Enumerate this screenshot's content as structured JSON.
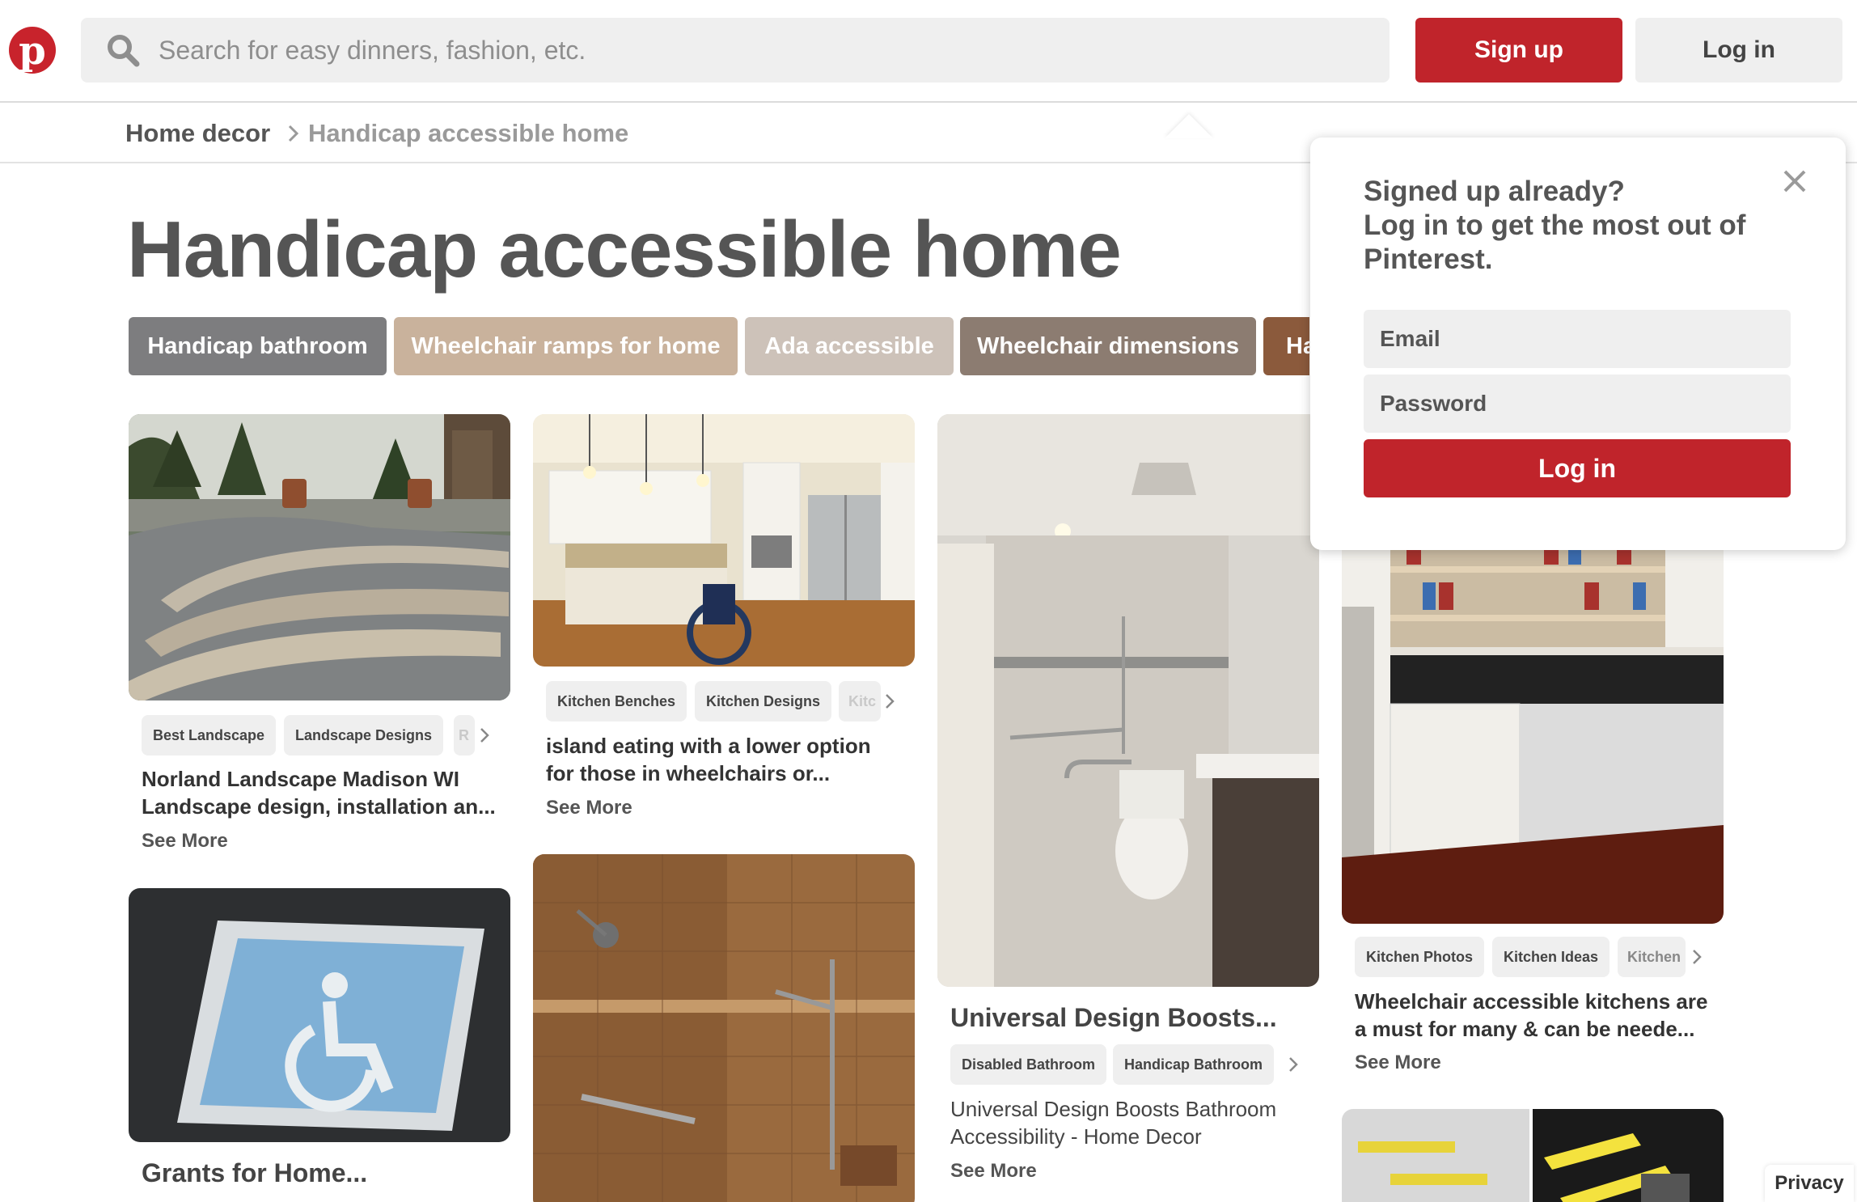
{
  "header": {
    "logo_letter": "p",
    "search_placeholder": "Search for easy dinners, fashion, etc.",
    "signup_label": "Sign up",
    "login_label": "Log in"
  },
  "breadcrumb": {
    "parent": "Home decor",
    "current": "Handicap accessible home"
  },
  "page": {
    "title": "Handicap accessible home"
  },
  "guides": [
    {
      "label": "Handicap bathroom",
      "color": "#7d7d7f"
    },
    {
      "label": "Wheelchair ramps for home",
      "color": "#c9b29c"
    },
    {
      "label": "Ada accessible",
      "color": "#cdc2b9"
    },
    {
      "label": "Wheelchair dimensions",
      "color": "#8c7c71"
    },
    {
      "label": "Ha",
      "color": "#8b5a3c"
    }
  ],
  "pins": {
    "landscape": {
      "tags": [
        "Best Landscape",
        "Landscape Designs",
        "R"
      ],
      "desc_line1": "Norland Landscape Madison WI",
      "desc_line2": "Landscape design, installation an...",
      "see_more": "See More"
    },
    "parking": {
      "title": "Grants for Home..."
    },
    "kitchen_island": {
      "tags": [
        "Kitchen Benches",
        "Kitchen Designs",
        "Kitc"
      ],
      "desc_line1": "island eating with a lower option",
      "desc_line2": "for those in wheelchairs or...",
      "see_more": "See More"
    },
    "universal": {
      "title": "Universal Design Boosts...",
      "tags": [
        "Disabled Bathroom",
        "Handicap Bathroom"
      ],
      "desc_line1": "Universal Design Boosts Bathroom",
      "desc_line2": "Accessibility - Home Decor",
      "see_more": "See More"
    },
    "kitchen_access": {
      "tags": [
        "Kitchen Photos",
        "Kitchen Ideas",
        "Kitchen"
      ],
      "desc_line1": "Wheelchair accessible kitchens are",
      "desc_line2": "a must for many & can be neede...",
      "see_more": "See More"
    }
  },
  "login_popover": {
    "heading_line1": "Signed up already?",
    "heading_line2": "Log in to get the most out of",
    "heading_line3": "Pinterest.",
    "email_placeholder": "Email",
    "password_placeholder": "Password",
    "login_button": "Log in"
  },
  "footer": {
    "privacy": "Privacy"
  },
  "colors": {
    "brand_red": "#c0242b",
    "chip_bg": "#efefef"
  }
}
